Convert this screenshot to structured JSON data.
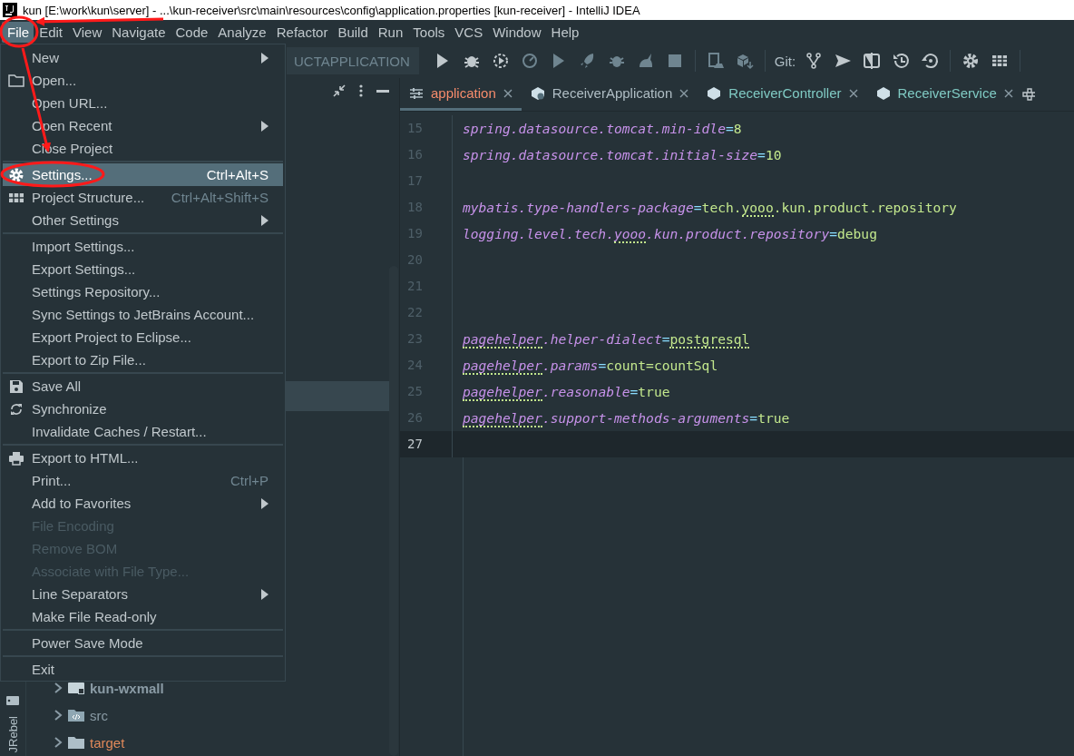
{
  "window": {
    "title": "kun [E:\\work\\kun\\server] - ...\\kun-receiver\\src\\main\\resources\\config\\application.properties [kun-receiver] - IntelliJ IDEA"
  },
  "menubar": [
    {
      "label": "File",
      "selected": true
    },
    {
      "label": "Edit",
      "selected": false
    },
    {
      "label": "View",
      "selected": false
    },
    {
      "label": "Navigate",
      "selected": false
    },
    {
      "label": "Code",
      "selected": false
    },
    {
      "label": "Analyze",
      "selected": false
    },
    {
      "label": "Refactor",
      "selected": false
    },
    {
      "label": "Build",
      "selected": false
    },
    {
      "label": "Run",
      "selected": false
    },
    {
      "label": "Tools",
      "selected": false
    },
    {
      "label": "VCS",
      "selected": false
    },
    {
      "label": "Window",
      "selected": false
    },
    {
      "label": "Help",
      "selected": false
    }
  ],
  "toolbar": {
    "run_config": "UCTAPPLICATION",
    "git_label": "Git:"
  },
  "file_menu": [
    {
      "kind": "item",
      "label": "New",
      "submenu": true,
      "disabled": false,
      "selected": false
    },
    {
      "kind": "item",
      "label": "Open...",
      "submenu": false,
      "disabled": false,
      "selected": false
    },
    {
      "kind": "item",
      "label": "Open URL...",
      "submenu": false,
      "disabled": false,
      "selected": false
    },
    {
      "kind": "item",
      "label": "Open Recent",
      "submenu": true,
      "disabled": false,
      "selected": false
    },
    {
      "kind": "item",
      "label": "Close Project",
      "submenu": false,
      "disabled": false,
      "selected": false
    },
    {
      "kind": "separator"
    },
    {
      "kind": "item",
      "label": "Settings...",
      "shortcut": "Ctrl+Alt+S",
      "submenu": false,
      "disabled": false,
      "selected": true
    },
    {
      "kind": "item",
      "label": "Project Structure...",
      "shortcut": "Ctrl+Alt+Shift+S",
      "submenu": false,
      "disabled": false,
      "selected": false
    },
    {
      "kind": "item",
      "label": "Other Settings",
      "submenu": true,
      "disabled": false,
      "selected": false
    },
    {
      "kind": "separator"
    },
    {
      "kind": "item",
      "label": "Import Settings...",
      "submenu": false,
      "disabled": false,
      "selected": false
    },
    {
      "kind": "item",
      "label": "Export Settings...",
      "submenu": false,
      "disabled": false,
      "selected": false
    },
    {
      "kind": "item",
      "label": "Settings Repository...",
      "submenu": false,
      "disabled": false,
      "selected": false
    },
    {
      "kind": "item",
      "label": "Sync Settings to JetBrains Account...",
      "submenu": false,
      "disabled": false,
      "selected": false
    },
    {
      "kind": "item",
      "label": "Export Project to Eclipse...",
      "submenu": false,
      "disabled": false,
      "selected": false
    },
    {
      "kind": "item",
      "label": "Export to Zip File...",
      "submenu": false,
      "disabled": false,
      "selected": false
    },
    {
      "kind": "separator"
    },
    {
      "kind": "item",
      "label": "Save All",
      "submenu": false,
      "disabled": false,
      "selected": false
    },
    {
      "kind": "item",
      "label": "Synchronize",
      "submenu": false,
      "disabled": false,
      "selected": false
    },
    {
      "kind": "item",
      "label": "Invalidate Caches / Restart...",
      "submenu": false,
      "disabled": false,
      "selected": false
    },
    {
      "kind": "separator"
    },
    {
      "kind": "item",
      "label": "Export to HTML...",
      "submenu": false,
      "disabled": false,
      "selected": false
    },
    {
      "kind": "item",
      "label": "Print...",
      "shortcut": "Ctrl+P",
      "submenu": false,
      "disabled": false,
      "selected": false
    },
    {
      "kind": "item",
      "label": "Add to Favorites",
      "submenu": true,
      "disabled": false,
      "selected": false
    },
    {
      "kind": "item",
      "label": "File Encoding",
      "submenu": false,
      "disabled": true,
      "selected": false
    },
    {
      "kind": "item",
      "label": "Remove BOM",
      "submenu": false,
      "disabled": true,
      "selected": false
    },
    {
      "kind": "item",
      "label": "Associate with File Type...",
      "submenu": false,
      "disabled": true,
      "selected": false
    },
    {
      "kind": "item",
      "label": "Line Separators",
      "submenu": true,
      "disabled": false,
      "selected": false
    },
    {
      "kind": "item",
      "label": "Make File Read-only",
      "submenu": false,
      "disabled": false,
      "selected": false
    },
    {
      "kind": "separator"
    },
    {
      "kind": "item",
      "label": "Power Save Mode",
      "submenu": false,
      "disabled": false,
      "selected": false
    },
    {
      "kind": "separator"
    },
    {
      "kind": "item",
      "label": "Exit",
      "submenu": false,
      "disabled": false,
      "selected": false
    }
  ],
  "project_tree": [
    {
      "label": "kun-wxmall",
      "kind": "module"
    },
    {
      "label": "src",
      "kind": "source"
    },
    {
      "label": "target",
      "kind": "excluded"
    }
  ],
  "side_strip": {
    "label": "JRebel"
  },
  "tabs": [
    {
      "label": "application",
      "selected": true,
      "color": "#f78c6c"
    },
    {
      "label": "ReceiverApplication",
      "selected": false,
      "color": "#b0bec5"
    },
    {
      "label": "ReceiverController",
      "selected": false,
      "color": "#80cbc4"
    },
    {
      "label": "ReceiverService",
      "selected": false,
      "color": "#80cbc4"
    }
  ],
  "editor": {
    "lines": [
      {
        "number": "15",
        "current": false,
        "tokens": [
          {
            "text": "spring.datasource.tomcat.min-idle",
            "kind": "key",
            "typo": false
          },
          {
            "text": "=",
            "kind": "op",
            "typo": false
          },
          {
            "text": "8",
            "kind": "value",
            "typo": false
          }
        ]
      },
      {
        "number": "16",
        "current": false,
        "tokens": [
          {
            "text": "spring.datasource.tomcat.initial-size",
            "kind": "key",
            "typo": false
          },
          {
            "text": "=",
            "kind": "op",
            "typo": false
          },
          {
            "text": "10",
            "kind": "value",
            "typo": false
          }
        ]
      },
      {
        "number": "17",
        "current": false
      },
      {
        "number": "18",
        "current": false,
        "tokens": [
          {
            "text": "mybatis.type-handlers-package",
            "kind": "key",
            "typo": false
          },
          {
            "text": "=",
            "kind": "op",
            "typo": false
          },
          {
            "text": "tech.",
            "kind": "value",
            "typo": false
          },
          {
            "text": "yooo",
            "kind": "value",
            "typo": true
          },
          {
            "text": ".kun.product.repository",
            "kind": "value",
            "typo": false
          }
        ]
      },
      {
        "number": "19",
        "current": false,
        "tokens": [
          {
            "text": "logging.level.tech.",
            "kind": "key",
            "typo": false
          },
          {
            "text": "yooo",
            "kind": "key",
            "typo": true
          },
          {
            "text": ".kun.product.repository",
            "kind": "key",
            "typo": false
          },
          {
            "text": "=",
            "kind": "op",
            "typo": false
          },
          {
            "text": "debug",
            "kind": "value",
            "typo": false
          }
        ]
      },
      {
        "number": "20",
        "current": false
      },
      {
        "number": "21",
        "current": false
      },
      {
        "number": "22",
        "current": false
      },
      {
        "number": "23",
        "current": false,
        "tokens": [
          {
            "text": "pagehelper",
            "kind": "key",
            "typo": true
          },
          {
            "text": ".helper-dialect",
            "kind": "key",
            "typo": false
          },
          {
            "text": "=",
            "kind": "op",
            "typo": false
          },
          {
            "text": "postgresql",
            "kind": "value",
            "typo": true
          }
        ]
      },
      {
        "number": "24",
        "current": false,
        "tokens": [
          {
            "text": "pagehelper",
            "kind": "key",
            "typo": true
          },
          {
            "text": ".params",
            "kind": "key",
            "typo": false
          },
          {
            "text": "=",
            "kind": "op",
            "typo": false
          },
          {
            "text": "count=countSql",
            "kind": "value",
            "typo": false
          }
        ]
      },
      {
        "number": "25",
        "current": false,
        "tokens": [
          {
            "text": "pagehelper",
            "kind": "key",
            "typo": true
          },
          {
            "text": ".reasonable",
            "kind": "key",
            "typo": false
          },
          {
            "text": "=",
            "kind": "op",
            "typo": false
          },
          {
            "text": "true",
            "kind": "value",
            "typo": false
          }
        ]
      },
      {
        "number": "26",
        "current": false,
        "tokens": [
          {
            "text": "pagehelper",
            "kind": "key",
            "typo": true
          },
          {
            "text": ".support-methods-arguments",
            "kind": "key",
            "typo": false
          },
          {
            "text": "=",
            "kind": "op",
            "typo": false
          },
          {
            "text": "true",
            "kind": "value",
            "typo": false
          }
        ]
      },
      {
        "number": "27",
        "current": true
      }
    ]
  }
}
